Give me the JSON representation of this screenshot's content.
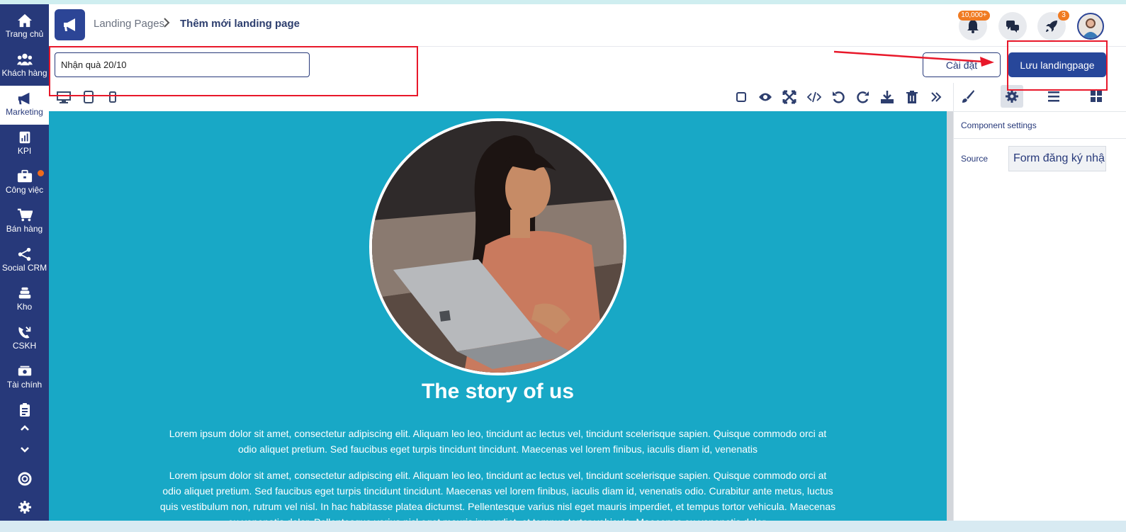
{
  "sidebar": {
    "items": [
      {
        "label": "Trang chủ",
        "icon": "home-icon"
      },
      {
        "label": "Khách hàng",
        "icon": "users-icon"
      },
      {
        "label": "Marketing",
        "icon": "megaphone-icon"
      },
      {
        "label": "KPI",
        "icon": "chart-icon"
      },
      {
        "label": "Công việc",
        "icon": "briefcase-icon"
      },
      {
        "label": "Bán hàng",
        "icon": "cart-icon"
      },
      {
        "label": "Social CRM",
        "icon": "share-icon"
      },
      {
        "label": "Kho",
        "icon": "stack-icon"
      },
      {
        "label": "CSKH",
        "icon": "phone-icon"
      },
      {
        "label": "Tài chính",
        "icon": "money-icon"
      }
    ],
    "active_index": 2
  },
  "header": {
    "breadcrumb_root": "Landing Pages",
    "breadcrumb_current": "Thêm mới landing page",
    "notification_badge": "10,000+",
    "rocket_badge": "3"
  },
  "titlebar": {
    "page_name_value": "Nhận quà 20/10",
    "settings_label": "Cài đặt",
    "save_label": "Lưu landingpage"
  },
  "canvas": {
    "heading": "The story of us",
    "paragraph1": "Lorem ipsum dolor sit amet, consectetur adipiscing elit. Aliquam leo leo, tincidunt ac lectus vel, tincidunt scelerisque sapien. Quisque commodo orci at odio aliquet pretium. Sed faucibus eget turpis tincidunt tincidunt. Maecenas vel lorem finibus, iaculis diam id, venenatis",
    "paragraph2": "Lorem ipsum dolor sit amet, consectetur adipiscing elit. Aliquam leo leo, tincidunt ac lectus vel, tincidunt scelerisque sapien. Quisque commodo orci at odio aliquet pretium. Sed faucibus eget turpis tincidunt tincidunt. Maecenas vel lorem finibus, iaculis diam id, venenatis odio. Curabitur ante metus, luctus quis vestibulum non, rutrum vel nisl. In hac habitasse platea dictumst. Pellentesque varius nisl eget mauris imperdiet, et tempus tortor vehicula. Maecenas eu venenatis dolor. Pellentesque varius nisl eget mauris imperdiet, et tempus tortor vehicula. Maecenas eu venenatis dolor."
  },
  "right_panel": {
    "section_title": "Component settings",
    "source_label": "Source",
    "source_value": "Form đăng ký nhận quà"
  },
  "colors": {
    "sidebar_bg": "#27397a",
    "accent": "#27479a",
    "canvas_bg": "#18a8c6",
    "badge": "#f07b22",
    "annotation_red": "#e8182a"
  }
}
